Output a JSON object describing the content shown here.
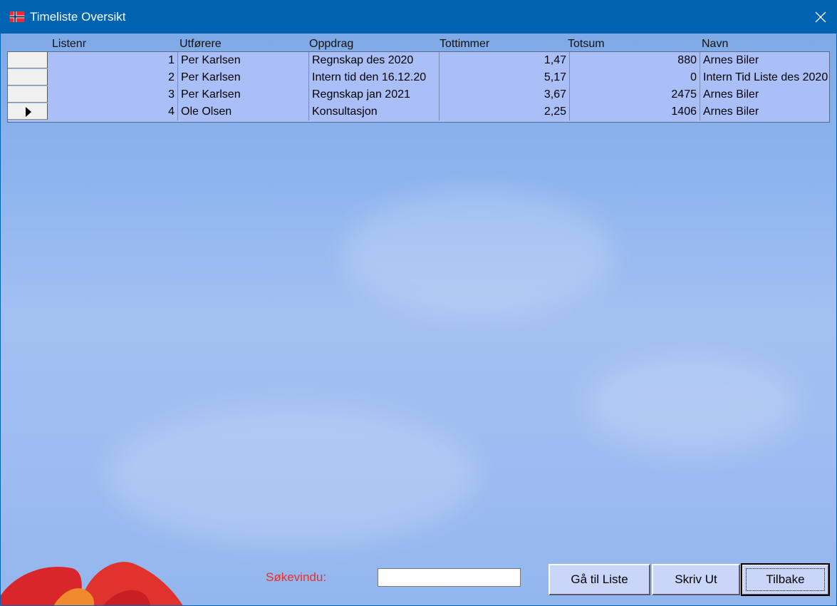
{
  "window": {
    "title": "Timeliste Oversikt",
    "close_icon": "close-icon",
    "app_icon": "norway-flag-icon",
    "title_color": "#0063b1"
  },
  "grid": {
    "columns": [
      "Listenr",
      "Utførere",
      "Oppdrag",
      "Tottimmer",
      "Totsum",
      "Navn"
    ],
    "rows": [
      {
        "listenr": "1",
        "utforere": "Per Karlsen",
        "oppdrag": "Regnskap des 2020",
        "tottimmer": "1,47",
        "totsum": "880",
        "navn": "Arnes Biler"
      },
      {
        "listenr": "2",
        "utforere": "Per Karlsen",
        "oppdrag": "Intern tid den 16.12.20",
        "tottimmer": "5,17",
        "totsum": "0",
        "navn": "Intern Tid Liste des 2020"
      },
      {
        "listenr": "3",
        "utforere": "Per Karlsen",
        "oppdrag": "Regnskap jan 2021",
        "tottimmer": "3,67",
        "totsum": "2475",
        "navn": "Arnes Biler"
      },
      {
        "listenr": "4",
        "utforere": "Ole Olsen",
        "oppdrag": "Konsultasjon",
        "tottimmer": "2,25",
        "totsum": "1406",
        "navn": "Arnes Biler"
      }
    ],
    "current_row_icon": "record-pointer-icon",
    "row_color": "#aabff7"
  },
  "search": {
    "label": "Søkevindu:",
    "value": "",
    "placeholder": "",
    "label_color": "#e8302a"
  },
  "buttons": {
    "goto_list": "Gå til Liste",
    "print": "Skriv Ut",
    "back": "Tilbake"
  }
}
